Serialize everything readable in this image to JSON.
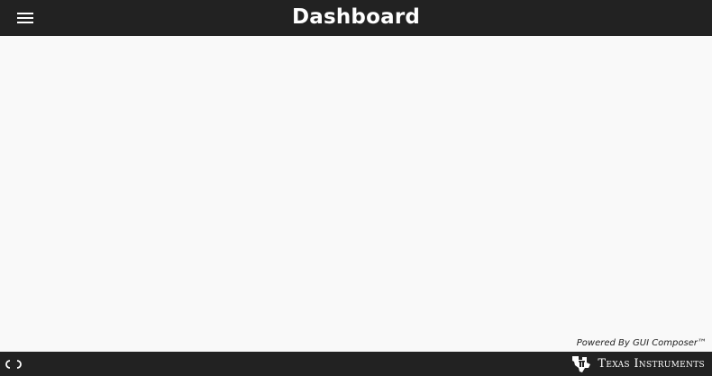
{
  "header": {
    "title": "Dashboard",
    "menu_icon": "hamburger-menu-icon"
  },
  "main": {
    "powered_by": "Powered By GUI Composer™"
  },
  "footer": {
    "connection_icon": "disconnected-plug-icon",
    "brand_name": "Texas Instruments",
    "brand_logo_icon": "ti-state-logo-icon"
  },
  "colors": {
    "header_bg": "#222222",
    "footer_bg": "#222222",
    "content_bg": "#f9f9f9",
    "header_text": "#ffffff"
  }
}
